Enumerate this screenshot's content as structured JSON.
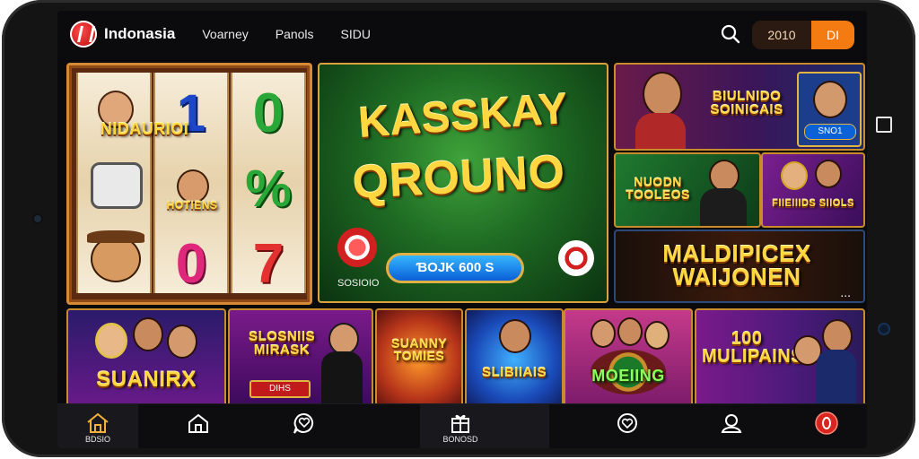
{
  "header": {
    "logo_text": "Indonasia",
    "nav": [
      "Voarney",
      "Panols",
      "SIDU"
    ],
    "coins_amount": "2010",
    "coins_button": "DI"
  },
  "slot": {
    "banner": "NIDAURIOI",
    "middle_label": "HOTIENS"
  },
  "hero": {
    "title_line1": "KASSKAY",
    "title_line2": "QROUNO",
    "button": "ƁOJK 600 S",
    "caption": "SOSIOIO"
  },
  "right_tiles": {
    "top_title": "BIULNIDO SOINICAIS",
    "top_badge": "SNO1",
    "mid1_title": "NUODN TOOLEOS",
    "mid2_title": "FIIEIIIDS SIIOLS",
    "wide_title": "MALDIPICEX WAIJONEN",
    "wide_dots": "..."
  },
  "bottom_tiles": [
    {
      "title": "SUANIRX"
    },
    {
      "title": "SLOSNIIS MIRASK",
      "badge": "DIHS"
    },
    {
      "title": "SUANNY TOMIES"
    },
    {
      "title": "SLIBIIAIS"
    },
    {
      "title": "MOEIING"
    },
    {
      "title": "100 MULIPAINS"
    }
  ],
  "bottom_nav": [
    {
      "icon": "home-icon",
      "label": "BDSIO"
    },
    {
      "icon": "house-outline-icon",
      "label": ""
    },
    {
      "icon": "heart-chat-icon",
      "label": ""
    },
    {
      "icon": "gift-icon",
      "label": "BONOSD"
    },
    {
      "icon": "chat-heart-icon",
      "label": ""
    },
    {
      "icon": "profile-icon",
      "label": ""
    },
    {
      "icon": "chip-icon",
      "label": ""
    }
  ],
  "colors": {
    "accent_orange": "#f47a12",
    "gold": "#ffd740",
    "play_blue": "#1a86ef",
    "hero_green": "#2f8a2d"
  }
}
